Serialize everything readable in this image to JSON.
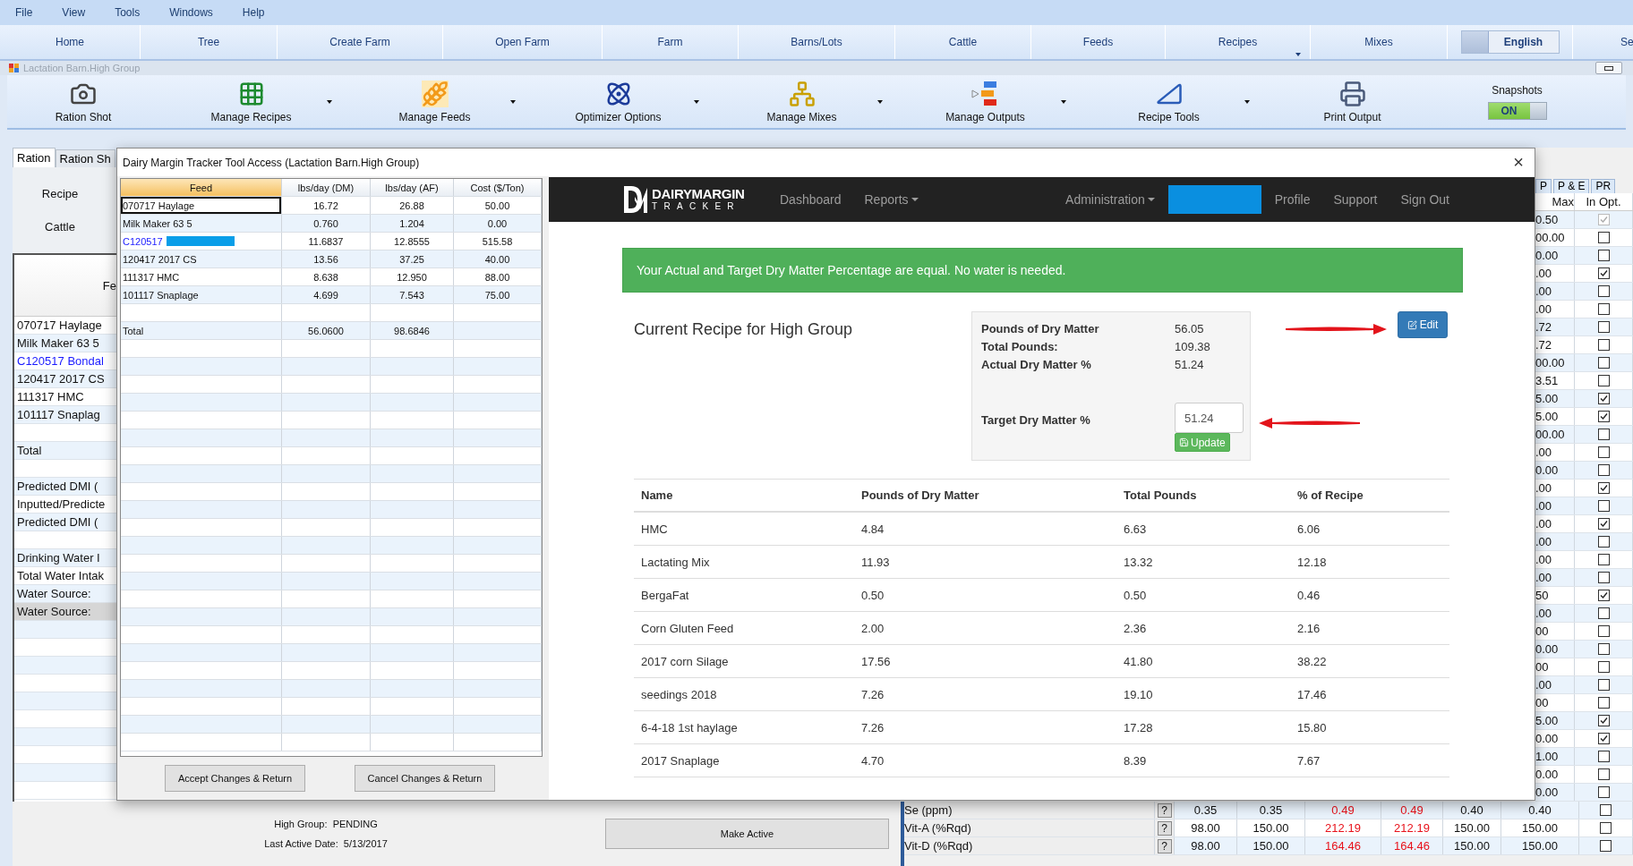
{
  "menu_bar": [
    "File",
    "View",
    "Tools",
    "Windows",
    "Help"
  ],
  "nav_tabs": [
    {
      "label": "Home",
      "dropdown": false
    },
    {
      "label": "Tree",
      "dropdown": false
    },
    {
      "label": "Create Farm",
      "dropdown": false
    },
    {
      "label": "Open Farm",
      "dropdown": false
    },
    {
      "label": "Farm",
      "dropdown": false
    },
    {
      "label": "Barns/Lots",
      "dropdown": false
    },
    {
      "label": "Cattle",
      "dropdown": false
    },
    {
      "label": "Feeds",
      "dropdown": false
    },
    {
      "label": "Recipes",
      "dropdown": true
    },
    {
      "label": "Mixes",
      "dropdown": false
    }
  ],
  "language_toggle": "English",
  "nav_cut_label": "Se",
  "child_window": {
    "title": "Lactation Barn.High Group"
  },
  "ribbon": [
    {
      "label": "Ration Shot",
      "dropdown": false
    },
    {
      "label": "Manage Recipes",
      "dropdown": true
    },
    {
      "label": "Manage Feeds",
      "dropdown": true
    },
    {
      "label": "Optimizer Options",
      "dropdown": true
    },
    {
      "label": "Manage Mixes",
      "dropdown": true
    },
    {
      "label": "Manage Outputs",
      "dropdown": true
    },
    {
      "label": "Recipe Tools",
      "dropdown": true
    },
    {
      "label": "Print Output",
      "dropdown": false
    }
  ],
  "snapshots": {
    "label": "Snapshots",
    "toggle": "ON",
    "on": true
  },
  "ration_tabs": [
    {
      "label": "Ration",
      "selected": true
    },
    {
      "label": "Ration Sh",
      "selected": false
    }
  ],
  "side_buttons": [
    "Recipe",
    "Cattle"
  ],
  "ration_grid": {
    "header": "Fe",
    "rows": [
      {
        "kind": "item",
        "label": "070717 Haylage",
        "link": false,
        "selected": false
      },
      {
        "kind": "item",
        "label": "Milk Maker 63 5",
        "link": false,
        "selected": false
      },
      {
        "kind": "item",
        "label": "C120517 Bondal",
        "link": true,
        "selected": false
      },
      {
        "kind": "item",
        "label": "120417 2017 CS",
        "link": false,
        "selected": false
      },
      {
        "kind": "item",
        "label": "111317 HMC",
        "link": false,
        "selected": false
      },
      {
        "kind": "item",
        "label": "101117 Snaplag",
        "link": false,
        "selected": false
      },
      {
        "kind": "blank",
        "selected": false
      },
      {
        "kind": "item",
        "label": "Total",
        "link": false,
        "selected": false
      },
      {
        "kind": "blank",
        "selected": false
      },
      {
        "kind": "item",
        "label": "Predicted DMI (",
        "link": false,
        "selected": false
      },
      {
        "kind": "item",
        "label": "Inputted/Predicte",
        "link": false,
        "selected": false
      },
      {
        "kind": "item",
        "label": "Predicted DMI (",
        "link": false,
        "selected": false
      },
      {
        "kind": "blank",
        "selected": false
      },
      {
        "kind": "item",
        "label": "Drinking Water I",
        "link": false,
        "selected": false
      },
      {
        "kind": "item",
        "label": "Total Water Intak",
        "link": false,
        "selected": false
      },
      {
        "kind": "item",
        "label": "Water Source:",
        "link": false,
        "selected": false
      },
      {
        "kind": "item",
        "label": "Water Source:",
        "link": false,
        "selected": true
      }
    ]
  },
  "nutrient_tabs": [
    "P",
    "P & E",
    "PR"
  ],
  "nutrient_grid": {
    "columns": [
      "Max",
      "In Opt."
    ],
    "rows": [
      {
        "max": "0.50",
        "in_opt": true,
        "disabled": true
      },
      {
        "max": "00.00",
        "in_opt": false,
        "disabled": false
      },
      {
        "max": "0.00",
        "in_opt": false,
        "disabled": false
      },
      {
        "max": ".00",
        "in_opt": true,
        "disabled": false
      },
      {
        "max": ".00",
        "in_opt": false,
        "disabled": false
      },
      {
        "max": ".00",
        "in_opt": false,
        "disabled": false
      },
      {
        "max": ".72",
        "in_opt": false,
        "disabled": false
      },
      {
        "max": ".72",
        "in_opt": false,
        "disabled": false
      },
      {
        "max": "00.00",
        "in_opt": false,
        "disabled": false
      },
      {
        "max": "3.51",
        "in_opt": false,
        "disabled": false
      },
      {
        "max": "5.00",
        "in_opt": true,
        "disabled": false
      },
      {
        "max": "5.00",
        "in_opt": true,
        "disabled": false
      },
      {
        "max": "00.00",
        "in_opt": false,
        "disabled": false
      },
      {
        "max": ".00",
        "in_opt": false,
        "disabled": false
      },
      {
        "max": "0.00",
        "in_opt": false,
        "disabled": false
      },
      {
        "max": ".00",
        "in_opt": true,
        "disabled": false
      },
      {
        "max": ".00",
        "in_opt": false,
        "disabled": false
      },
      {
        "max": ".00",
        "in_opt": true,
        "disabled": false
      },
      {
        "max": ".00",
        "in_opt": false,
        "disabled": false
      },
      {
        "max": ".00",
        "in_opt": false,
        "disabled": false
      },
      {
        "max": ".00",
        "in_opt": false,
        "disabled": false
      },
      {
        "max": "50",
        "in_opt": true,
        "disabled": false
      },
      {
        "max": ".00",
        "in_opt": false,
        "disabled": false
      },
      {
        "max": "00",
        "in_opt": false,
        "disabled": false
      },
      {
        "max": "0.00",
        "in_opt": false,
        "disabled": false
      },
      {
        "max": "00",
        "in_opt": false,
        "disabled": false
      },
      {
        "max": ".00",
        "in_opt": false,
        "disabled": false
      },
      {
        "max": "00",
        "in_opt": false,
        "disabled": false
      },
      {
        "max": "5.00",
        "in_opt": true,
        "disabled": false
      },
      {
        "max": "0.00",
        "in_opt": true,
        "disabled": false
      },
      {
        "max": "1.00",
        "in_opt": false,
        "disabled": false
      },
      {
        "max": "0.00",
        "in_opt": false,
        "disabled": false
      },
      {
        "max": "0.00",
        "in_opt": false,
        "disabled": false
      }
    ]
  },
  "nutrient_rows_bottom": [
    {
      "name": "Se (ppm)",
      "help": "?",
      "values": [
        {
          "text": "0.35",
          "alert": false
        },
        {
          "text": "0.35",
          "alert": false
        },
        {
          "text": "0.49",
          "alert": true
        },
        {
          "text": "0.49",
          "alert": true
        },
        {
          "text": "0.40",
          "alert": false
        },
        {
          "text": "0.40",
          "alert": false
        }
      ],
      "in_opt": false
    },
    {
      "name": "Vit-A (%Rqd)",
      "help": "?",
      "values": [
        {
          "text": "98.00",
          "alert": false
        },
        {
          "text": "150.00",
          "alert": false
        },
        {
          "text": "212.19",
          "alert": true
        },
        {
          "text": "212.19",
          "alert": true
        },
        {
          "text": "150.00",
          "alert": false
        },
        {
          "text": "150.00",
          "alert": false
        }
      ],
      "in_opt": false
    },
    {
      "name": "Vit-D (%Rqd)",
      "help": "?",
      "values": [
        {
          "text": "98.00",
          "alert": false
        },
        {
          "text": "150.00",
          "alert": false
        },
        {
          "text": "164.46",
          "alert": true
        },
        {
          "text": "164.46",
          "alert": true
        },
        {
          "text": "150.00",
          "alert": false
        },
        {
          "text": "150.00",
          "alert": false
        }
      ],
      "in_opt": false
    }
  ],
  "status": {
    "group": "High Group:  PENDING",
    "last_active": "Last Active Date:  5/13/2017"
  },
  "make_active_button": "Make Active",
  "dialog": {
    "title": "Dairy Margin Tracker Tool Access (Lactation Barn.High Group)",
    "close": "×",
    "feed_table": {
      "columns": [
        "Feed",
        "lbs/day (DM)",
        "lbs/day (AF)",
        "Cost ($/Ton)"
      ],
      "rows": [
        {
          "kind": "feed",
          "feed": "070717 Haylage",
          "dm": "16.72",
          "af": "26.88",
          "cost": "50.00",
          "link": false,
          "redacted": false,
          "selected": true
        },
        {
          "kind": "feed",
          "feed": "Milk Maker 63 5",
          "dm": "0.760",
          "af": "1.204",
          "cost": "0.00",
          "link": false,
          "redacted": false,
          "selected": false
        },
        {
          "kind": "feed",
          "feed": "C120517",
          "dm": "11.6837",
          "af": "12.8555",
          "cost": "515.58",
          "link": true,
          "redacted": true,
          "selected": false
        },
        {
          "kind": "feed",
          "feed": "120417 2017 CS",
          "dm": "13.56",
          "af": "37.25",
          "cost": "40.00",
          "link": false,
          "redacted": false,
          "selected": false
        },
        {
          "kind": "feed",
          "feed": "111317 HMC",
          "dm": "8.638",
          "af": "12.950",
          "cost": "88.00",
          "link": false,
          "redacted": false,
          "selected": false
        },
        {
          "kind": "feed",
          "feed": "101117 Snaplage",
          "dm": "4.699",
          "af": "7.543",
          "cost": "75.00",
          "link": false,
          "redacted": false,
          "selected": false
        },
        {
          "kind": "blank",
          "selected": false
        },
        {
          "kind": "total",
          "feed": "Total",
          "dm": "56.0600",
          "af": "98.6846",
          "selected": false
        }
      ]
    },
    "buttons": [
      "Accept Changes & Return",
      "Cancel Changes & Return"
    ],
    "web": {
      "brand": {
        "name": "DAIRYMARGIN",
        "tagline": "TRACKER"
      },
      "nav": [
        {
          "kind": "link",
          "label": "Dashboard",
          "dropdown": false
        },
        {
          "kind": "link",
          "label": "Reports",
          "dropdown": true
        }
      ],
      "nav_right": [
        {
          "kind": "link",
          "label": "Administration",
          "dropdown": true
        },
        {
          "kind": "redacted"
        },
        {
          "kind": "link",
          "label": "Profile",
          "dropdown": false
        },
        {
          "kind": "link",
          "label": "Support",
          "dropdown": false
        },
        {
          "kind": "link",
          "label": "Sign Out",
          "dropdown": false
        }
      ],
      "alert": "Your Actual and Target Dry Matter Percentage are equal. No water is needed.",
      "heading": "Current Recipe for High Group",
      "summary": [
        {
          "label": "Pounds of Dry Matter",
          "value": "56.05"
        },
        {
          "label": "Total Pounds:",
          "value": "109.38"
        },
        {
          "label": "Actual Dry Matter %",
          "value": "51.24"
        }
      ],
      "target": {
        "label": "Target Dry Matter %",
        "value": "51.24",
        "button": "Update"
      },
      "edit_button": "Edit",
      "table": {
        "columns": [
          "Name",
          "Pounds of Dry Matter",
          "Total Pounds",
          "% of Recipe"
        ],
        "rows": [
          [
            "HMC",
            "4.84",
            "6.63",
            "6.06"
          ],
          [
            "Lactating Mix",
            "11.93",
            "13.32",
            "12.18"
          ],
          [
            "BergaFat",
            "0.50",
            "0.50",
            "0.46"
          ],
          [
            "Corn Gluten Feed",
            "2.00",
            "2.36",
            "2.16"
          ],
          [
            "2017 corn Silage",
            "17.56",
            "41.80",
            "38.22"
          ],
          [
            "seedings 2018",
            "7.26",
            "19.10",
            "17.46"
          ],
          [
            "6-4-18 1st haylage",
            "7.26",
            "17.28",
            "15.80"
          ],
          [
            "2017 Snaplage",
            "4.70",
            "8.39",
            "7.67"
          ]
        ]
      }
    }
  }
}
